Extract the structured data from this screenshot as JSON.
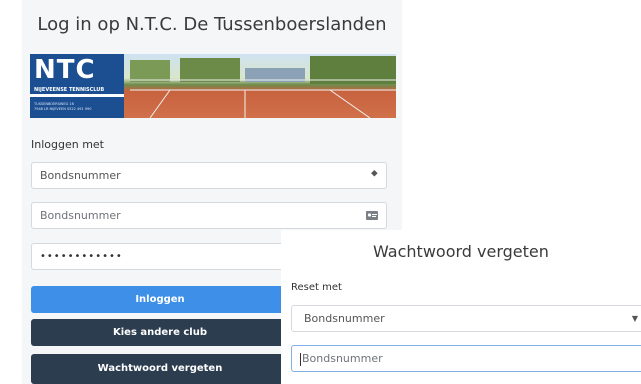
{
  "login": {
    "title": "Log in op N.T.C. De Tussenboerslanden",
    "logo": {
      "name": "NTC",
      "subtitle": "NIJEVEENSE TENNISCLUB",
      "address_line1": "TUSSENBOERSWEG 16",
      "address_line2": "7948 LR NIJEVEEN 0522 491 990"
    },
    "login_with_label": "Inloggen met",
    "login_method_selected": "Bondsnummer",
    "username_placeholder": "Bondsnummer",
    "password_value": "••••••••••••",
    "login_button": "Inloggen",
    "other_club_button": "Kies andere club",
    "forgot_password_button": "Wachtwoord vergeten"
  },
  "reset": {
    "title": "Wachtwoord vergeten",
    "reset_with_label": "Reset met",
    "reset_method_selected": "Bondsnummer",
    "number_placeholder": "Bondsnummer"
  },
  "colors": {
    "primary_button": "#3d8fe8",
    "dark_button": "#2c3d50",
    "logo_blue": "#1c4f92"
  },
  "icons": [
    "select-arrows-icon",
    "id-card-icon",
    "chevron-down-icon"
  ]
}
